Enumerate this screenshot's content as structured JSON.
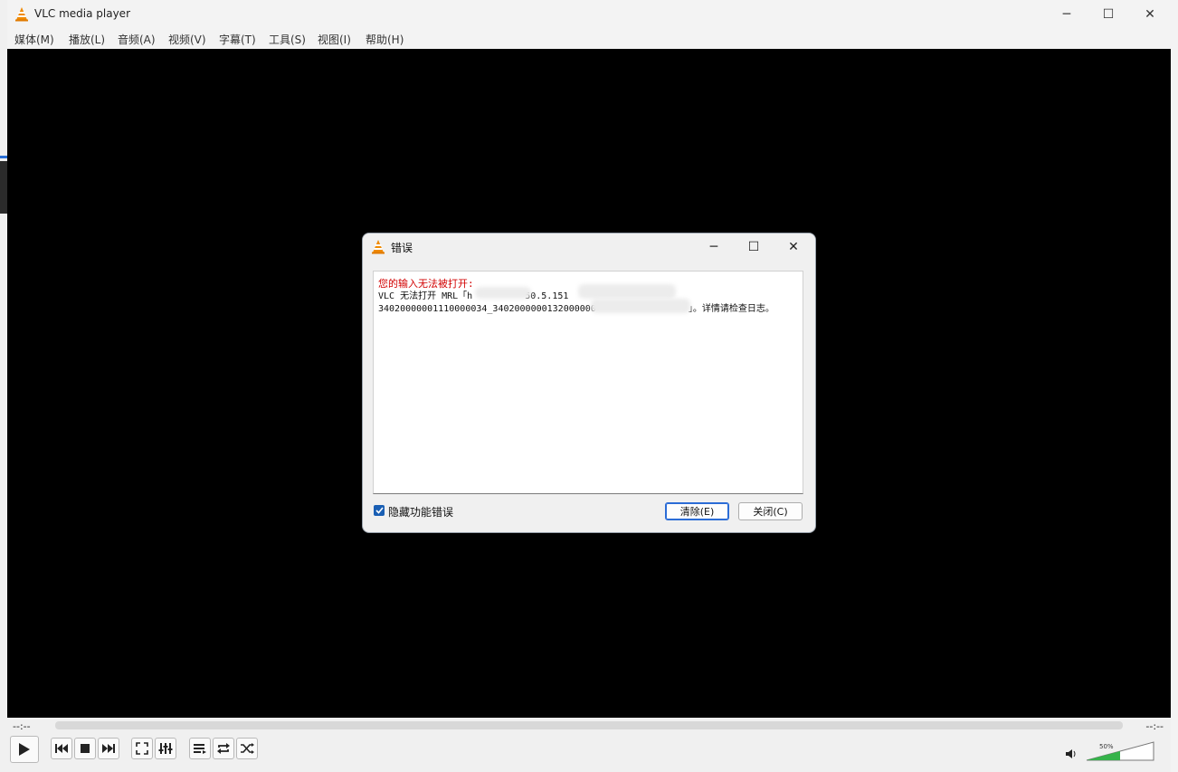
{
  "window": {
    "title": "VLC media player",
    "controls": {
      "minimize": "─",
      "maximize": "☐",
      "close": "✕"
    }
  },
  "menu": [
    {
      "label": "媒体(M)"
    },
    {
      "label": "播放(L)"
    },
    {
      "label": "音频(A)"
    },
    {
      "label": "视频(V)"
    },
    {
      "label": "字幕(T)"
    },
    {
      "label": "工具(S)"
    },
    {
      "label": "视图(I)"
    },
    {
      "label": "帮助(H)"
    }
  ],
  "dialog": {
    "title": "错误",
    "error_heading": "您的输入无法被打开:",
    "error_line1": "VLC 无法打开 MRL「h",
    "error_line1_tail": "50.5.151",
    "error_line2": "34020000001110000034_3402000000132000000",
    "error_line2_tail": "」。详情请检查日志。",
    "checkbox_label": "隐藏功能错误",
    "checkbox_checked": true,
    "clear_button": "清除(E)",
    "close_button": "关闭(C)"
  },
  "player": {
    "time_elapsed": "--:--",
    "time_total": "--:--",
    "volume_percent": "50%",
    "volume_level": 0.5
  },
  "colors": {
    "error_red": "#d20000",
    "accent_blue": "#1a5fb4",
    "volume_green": "#35b34a"
  }
}
